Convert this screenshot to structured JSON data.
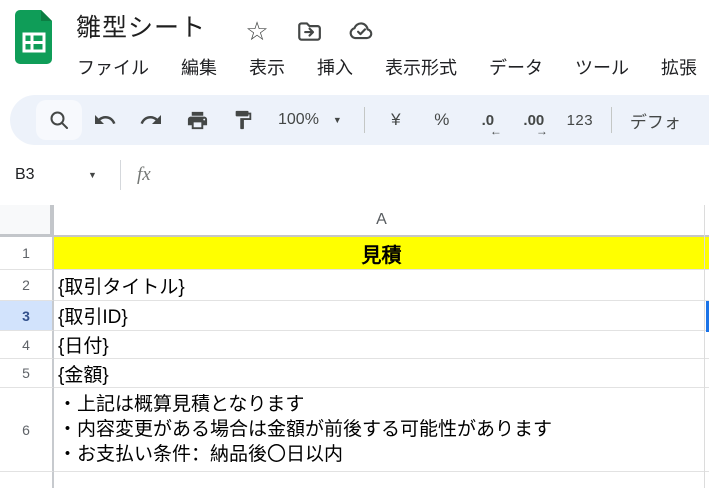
{
  "header": {
    "title": "雛型シート",
    "menu": [
      "ファイル",
      "編集",
      "表示",
      "挿入",
      "表示形式",
      "データ",
      "ツール",
      "拡張"
    ]
  },
  "toolbar": {
    "zoom": "100%",
    "currency": "¥",
    "percent": "%",
    "decrease_decimal": ".0",
    "increase_decimal": ".00",
    "more_formats": "123",
    "font_name": "デフォ"
  },
  "formula_bar": {
    "cell_ref": "B3",
    "fx": "fx"
  },
  "sheet": {
    "col_a": "A",
    "rows": [
      {
        "num": "1",
        "text": "見積"
      },
      {
        "num": "2",
        "text": "{取引タイトル}"
      },
      {
        "num": "3",
        "text": "{取引ID}",
        "selected": true
      },
      {
        "num": "4",
        "text": "{日付}"
      },
      {
        "num": "5",
        "text": "{金額}"
      },
      {
        "num": "6",
        "lines": [
          "・上記は概算見積となります",
          "・内容変更がある場合は金額が前後する可能性があります",
          "・お支払い条件：納品後〇日以内"
        ]
      }
    ]
  },
  "icons": {
    "star": "☆",
    "caret": "▼",
    "arrow_left": "←",
    "arrow_right": "→"
  },
  "colors": {
    "row1_bg": "#ffff00",
    "selection_blue": "#1a73e8",
    "selected_row_header_bg": "#d2e3fc",
    "toolbar_bg": "#edf2fa",
    "logo_green": "#0f9d58",
    "logo_fold_green": "#0c7e43"
  }
}
